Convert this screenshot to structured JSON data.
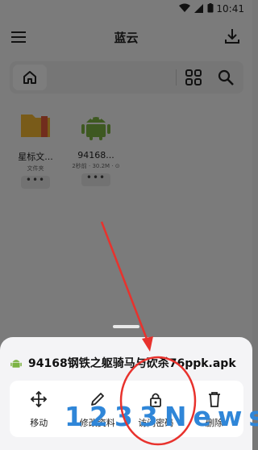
{
  "status_bar": {
    "time": "10:41"
  },
  "app_bar": {
    "title": "蓝云"
  },
  "breadcrumb": {
    "home_icon": "home-icon"
  },
  "files": [
    {
      "name": "星标文...",
      "meta": "文件夹",
      "more": "•••",
      "icon": "folder-star-icon"
    },
    {
      "name": "94168...",
      "meta": "2秒前 · 30.2M · ⊙",
      "more": "•••",
      "icon": "android-icon"
    }
  ],
  "sheet": {
    "title": "94168钢铁之躯骑马与砍杀76ppk.apk",
    "actions": [
      {
        "label": "移动",
        "icon": "move-icon"
      },
      {
        "label": "修改资料",
        "icon": "edit-icon"
      },
      {
        "label": "访问密码",
        "icon": "lock-icon"
      },
      {
        "label": "删除",
        "icon": "trash-icon"
      }
    ]
  },
  "colors": {
    "android_green": "#7cb342",
    "folder_yellow": "#f2b632",
    "annotation_red": "#e8322d",
    "watermark_blue": "#2f86d8"
  },
  "watermark": "1233News"
}
